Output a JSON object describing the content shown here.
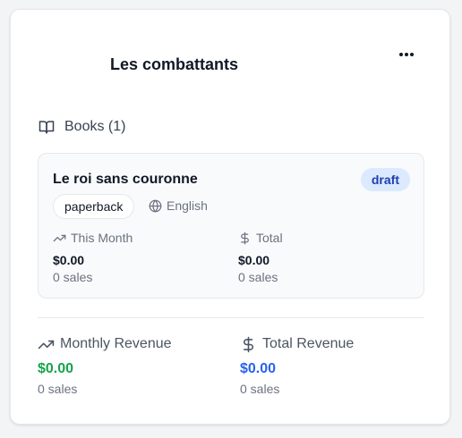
{
  "series": {
    "title": "Les combattants",
    "more_label": "More options"
  },
  "books_section": {
    "label": "Books (1)",
    "icon": "book-open-icon"
  },
  "books": [
    {
      "title": "Le roi sans couronne",
      "status": "draft",
      "format": "paperback",
      "language": "English",
      "this_month": {
        "label": "This Month",
        "amount": "$0.00",
        "sales": "0 sales"
      },
      "total": {
        "label": "Total",
        "amount": "$0.00",
        "sales": "0 sales"
      }
    }
  ],
  "revenue": {
    "monthly": {
      "label": "Monthly Revenue",
      "amount": "$0.00",
      "sales": "0 sales",
      "color": "#16a34a"
    },
    "total": {
      "label": "Total Revenue",
      "amount": "$0.00",
      "sales": "0 sales",
      "color": "#2563eb"
    }
  },
  "colors": {
    "badge_bg": "#dbeafe",
    "badge_text": "#1e40af"
  }
}
